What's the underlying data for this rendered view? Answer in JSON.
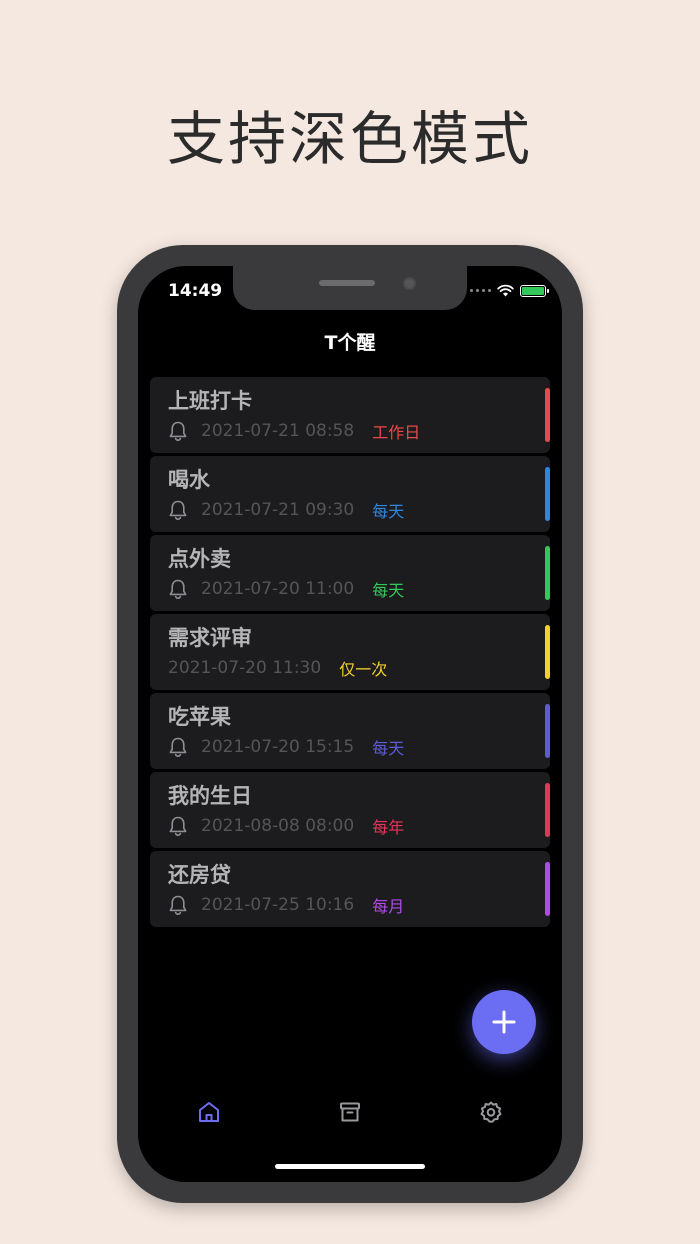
{
  "headline": "支持深色模式",
  "status_bar": {
    "time": "14:49"
  },
  "app": {
    "title": "T个醒"
  },
  "reminders": [
    {
      "title": "上班打卡",
      "time": "2021-07-21 08:58",
      "repeat": "工作日",
      "has_bell": true,
      "color": "#e84a4a"
    },
    {
      "title": "喝水",
      "time": "2021-07-21 09:30",
      "repeat": "每天",
      "has_bell": true,
      "color": "#2e86de"
    },
    {
      "title": "点外卖",
      "time": "2021-07-20 11:00",
      "repeat": "每天",
      "has_bell": true,
      "color": "#32c95a"
    },
    {
      "title": "需求评审",
      "time": "2021-07-20 11:30",
      "repeat": "仅一次",
      "has_bell": false,
      "color": "#f5d02a"
    },
    {
      "title": "吃苹果",
      "time": "2021-07-20 15:15",
      "repeat": "每天",
      "has_bell": true,
      "color": "#5f5ad8"
    },
    {
      "title": "我的生日",
      "time": "2021-08-08 08:00",
      "repeat": "每年",
      "has_bell": true,
      "color": "#e8345a"
    },
    {
      "title": "还房贷",
      "time": "2021-07-25 10:16",
      "repeat": "每月",
      "has_bell": true,
      "color": "#b04ae8"
    }
  ],
  "fab": {
    "icon": "plus-icon",
    "color": "#6b6ef3"
  },
  "tabs": [
    {
      "icon": "home-icon",
      "active": true
    },
    {
      "icon": "archive-icon",
      "active": false
    },
    {
      "icon": "gear-icon",
      "active": false
    }
  ],
  "colors": {
    "accent": "#6b6ef3",
    "tab_inactive": "#9a9a9e",
    "background": "#f5e8e0"
  }
}
